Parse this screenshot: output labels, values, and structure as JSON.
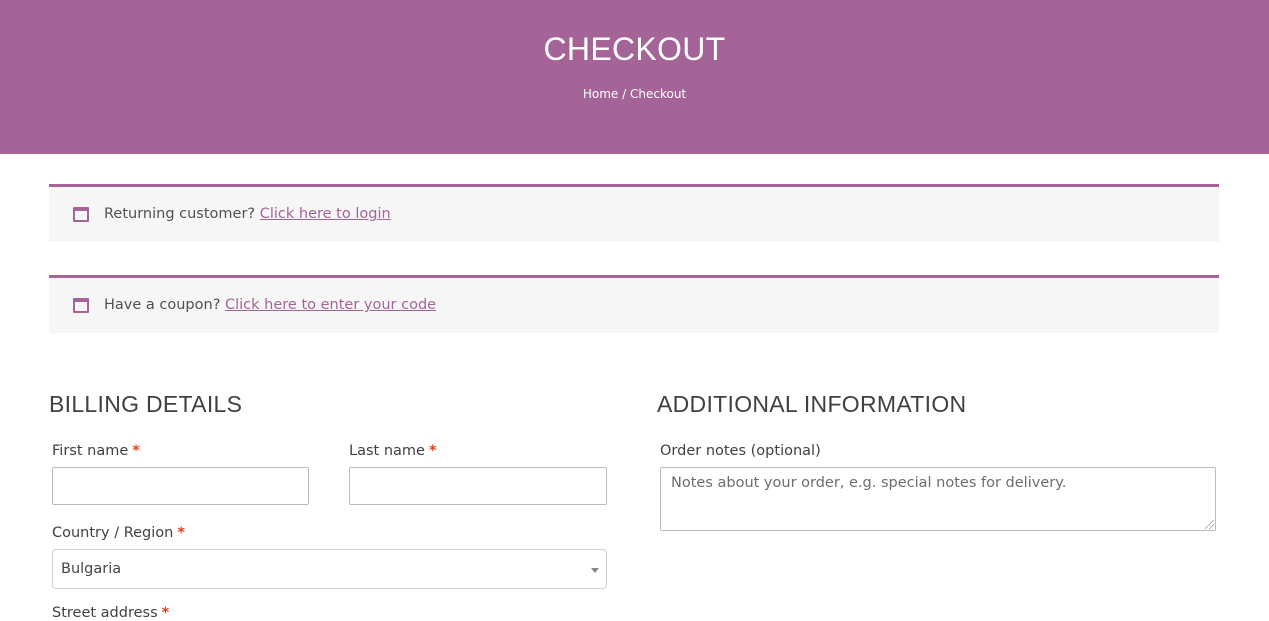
{
  "header": {
    "title": "CHECKOUT",
    "breadcrumb": {
      "home": "Home",
      "separator": " / ",
      "current": "Checkout"
    }
  },
  "notices": {
    "login": {
      "text": "Returning customer? ",
      "link": "Click here to login"
    },
    "coupon": {
      "text": "Have a coupon? ",
      "link": "Click here to enter your code"
    }
  },
  "billing": {
    "title": "BILLING DETAILS",
    "first_name": {
      "label": "First name",
      "required": "*",
      "value": ""
    },
    "last_name": {
      "label": "Last name",
      "required": "*",
      "value": ""
    },
    "country": {
      "label": "Country / Region",
      "required": "*",
      "value": "Bulgaria"
    },
    "street": {
      "label": "Street address",
      "required": "*"
    }
  },
  "additional": {
    "title": "ADDITIONAL INFORMATION",
    "order_notes": {
      "label": "Order notes (optional)",
      "placeholder": "Notes about your order, e.g. special notes for delivery."
    }
  },
  "colors": {
    "accent": "#a46497",
    "required": "#e2401c",
    "notice_bg": "#f7f6f7"
  },
  "icons": {
    "notice": "window-icon",
    "select": "caret-down-icon"
  }
}
